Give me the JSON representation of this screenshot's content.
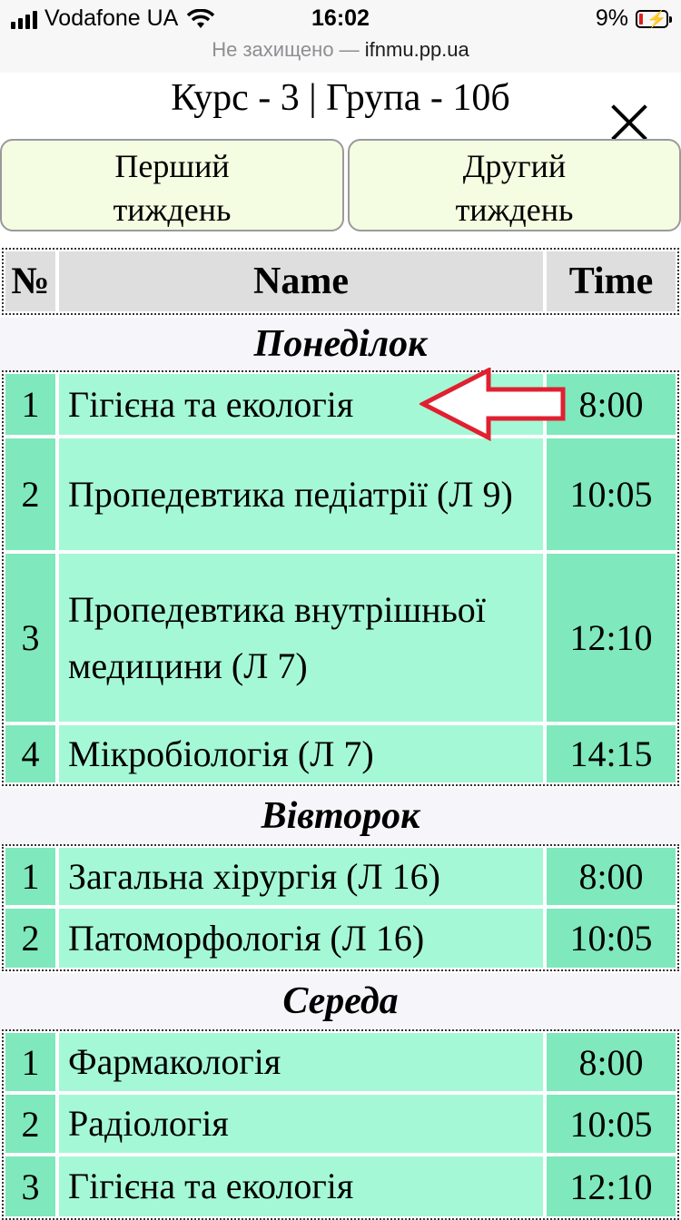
{
  "status_bar": {
    "carrier": "Vodafone UA",
    "time": "16:02",
    "battery": "9%",
    "url_prefix": "Не захищено —",
    "url_domain": "ifnmu.pp.ua"
  },
  "header": {
    "title": "Курс - 3 | Група - 10б",
    "week_buttons": [
      {
        "line1": "Перший",
        "line2": "тиждень"
      },
      {
        "line1": "Другий",
        "line2": "тиждень"
      }
    ]
  },
  "table_header": {
    "num": "№",
    "name": "Name",
    "time": "Time"
  },
  "days": [
    {
      "day": "Понеділок",
      "lessons": [
        {
          "num": "1",
          "name": "Гігієна та екологія",
          "time": "8:00"
        },
        {
          "num": "2",
          "name": "Пропедевтика педіатрії (Л 9)",
          "time": "10:05"
        },
        {
          "num": "3",
          "name": "Пропедевтика внутрішньої медицини (Л 7)",
          "time": "12:10"
        },
        {
          "num": "4",
          "name": "Мікробіологія (Л 7)",
          "time": "14:15"
        }
      ]
    },
    {
      "day": "Вівторок",
      "lessons": [
        {
          "num": "1",
          "name": "Загальна хірургія (Л 16)",
          "time": "8:00"
        },
        {
          "num": "2",
          "name": "Патоморфологія (Л 16)",
          "time": "10:05"
        }
      ]
    },
    {
      "day": "Середа",
      "lessons": [
        {
          "num": "1",
          "name": "Фармакологія",
          "time": "8:00"
        },
        {
          "num": "2",
          "name": "Радіологія",
          "time": "10:05"
        },
        {
          "num": "3",
          "name": "Гігієна та екологія",
          "time": "12:10"
        }
      ]
    }
  ],
  "colors": {
    "row_name_bg": "#a5f8d6",
    "row_side_bg": "#7fe8bc",
    "header_bg": "#dedede",
    "button_bg": "#f4fde2",
    "annotation_arrow": "#e02030"
  }
}
